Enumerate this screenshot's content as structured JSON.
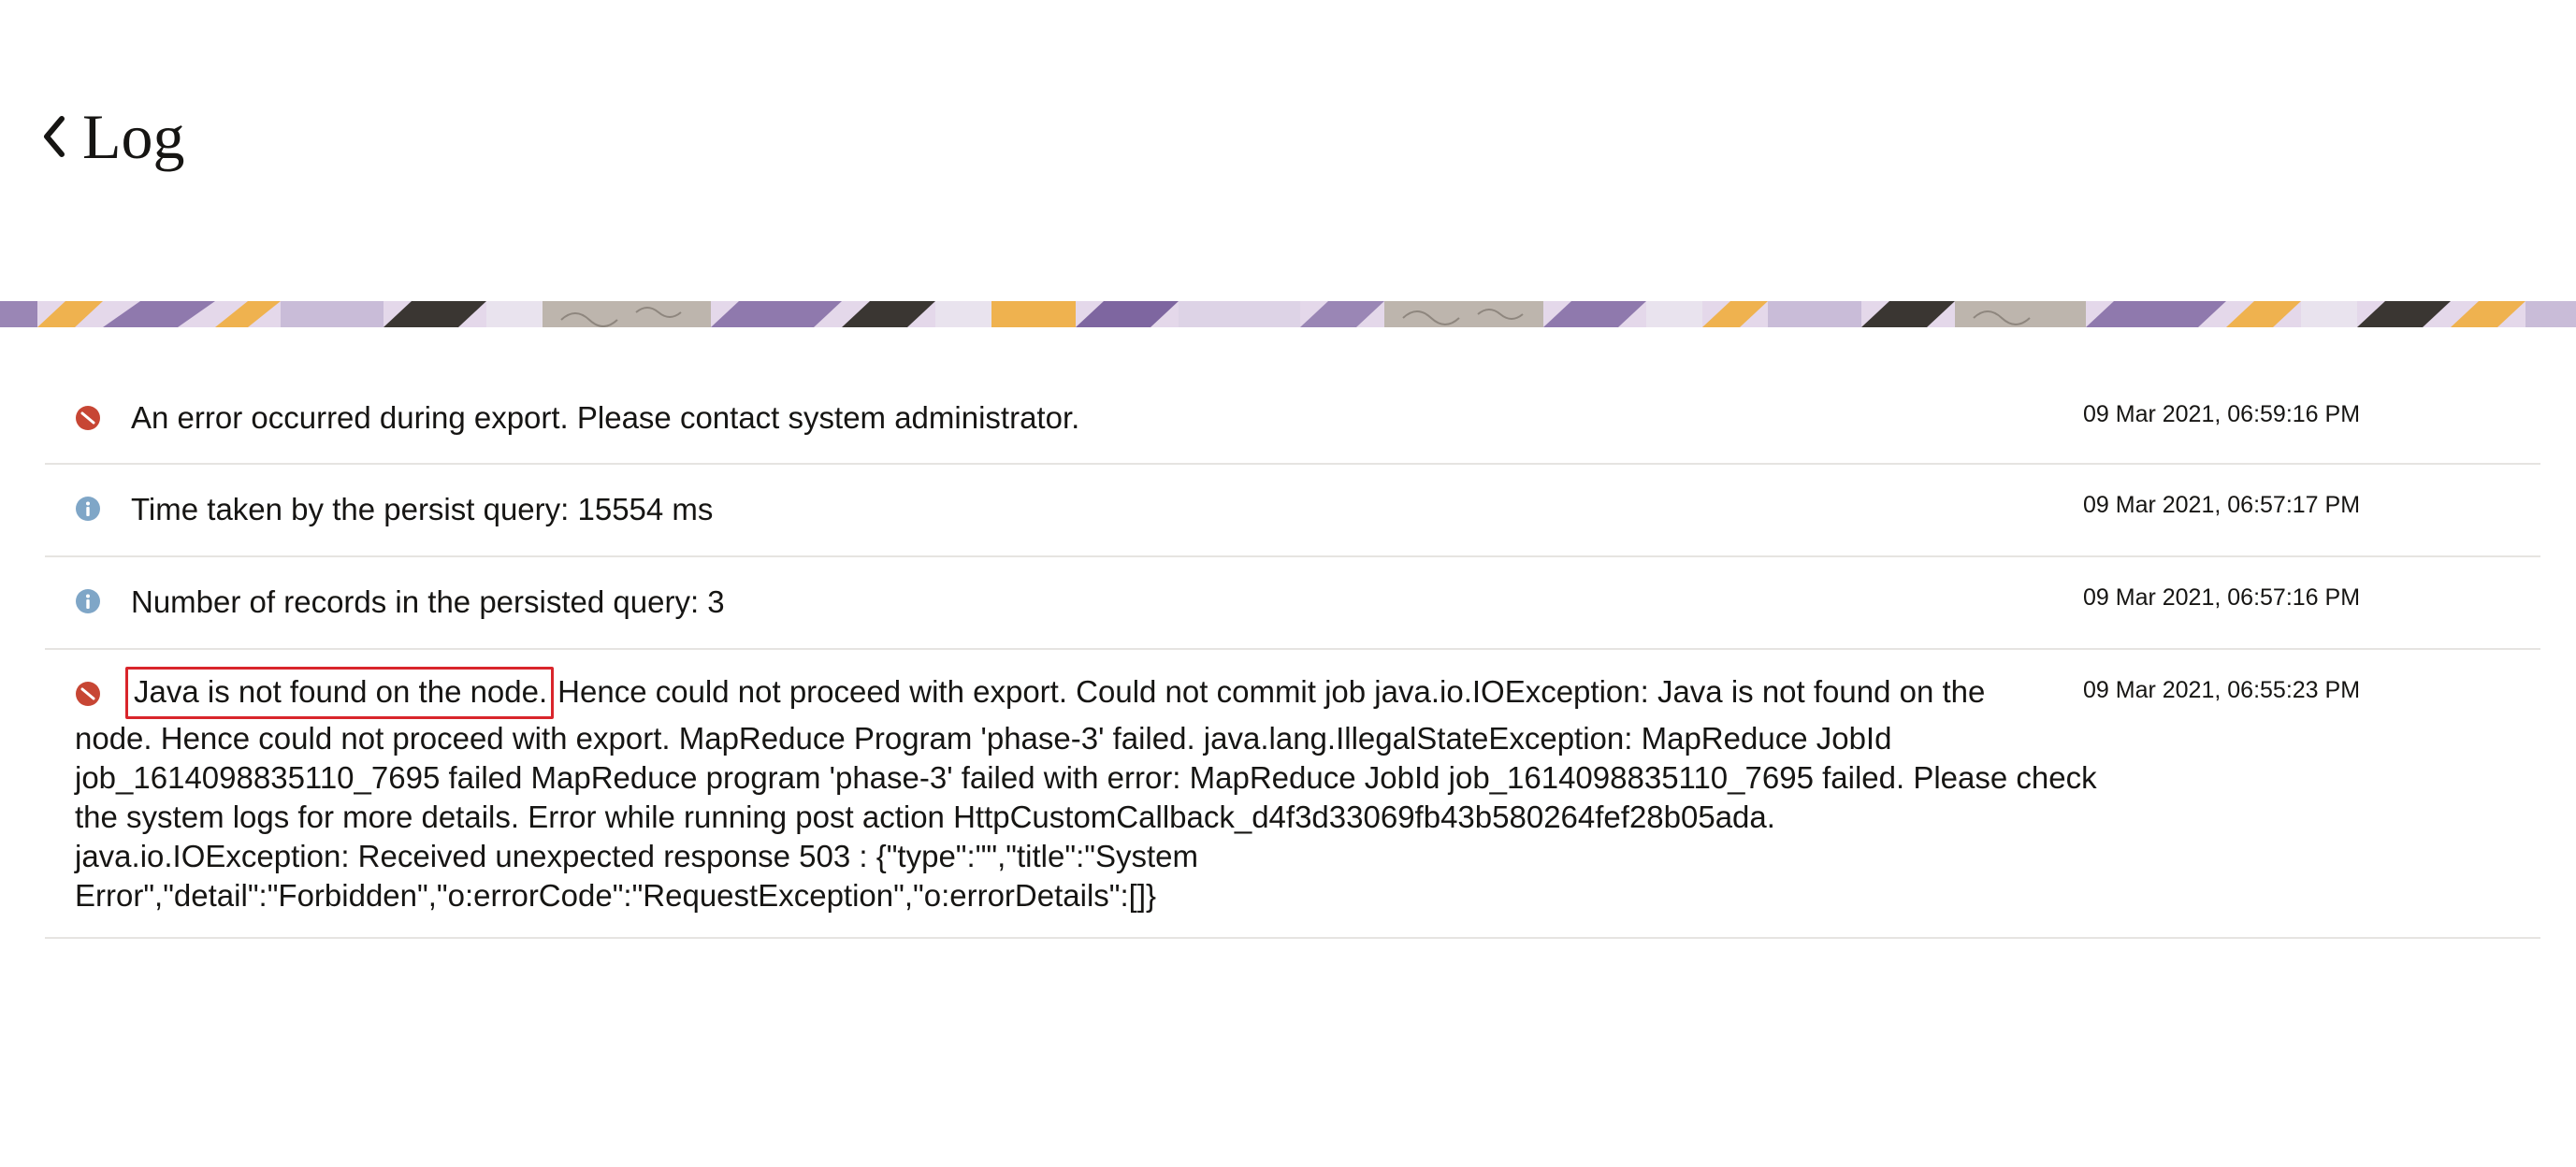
{
  "header": {
    "title": "Log",
    "back_icon": "chevron-left-icon"
  },
  "colors": {
    "error": "#c74634",
    "info": "#7fa6c7",
    "highlight_border": "#d9252b"
  },
  "logs": [
    {
      "level": "error",
      "icon": "error-icon",
      "message": "An error occurred during export. Please contact system administrator.",
      "timestamp": "09 Mar 2021, 06:59:16 PM"
    },
    {
      "level": "info",
      "icon": "info-icon",
      "message": "Time taken by the persist query: 15554 ms",
      "timestamp": "09 Mar 2021, 06:57:17 PM"
    },
    {
      "level": "info",
      "icon": "info-icon",
      "message": "Number of records in the persisted query: 3",
      "timestamp": "09 Mar 2021, 06:57:16 PM"
    },
    {
      "level": "error",
      "icon": "error-icon",
      "message_highlight": "Java is not found on the node.",
      "message_line1": "Hence could not proceed with export. Could not commit job java.io.IOException: Java is not found on the",
      "message_line2": "node. Hence could not proceed with export. MapReduce Program 'phase-3' failed. java.lang.IllegalStateException: MapReduce JobId",
      "message_line3": "job_1614098835110_7695 failed MapReduce program 'phase-3' failed with error: MapReduce JobId job_1614098835110_7695 failed. Please check",
      "message_line4": "the system logs for more details. Error while running post action HttpCustomCallback_d4f3d33069fb43b580264fef28b05ada.",
      "message_line5": "java.io.IOException: Received unexpected response 503 : {\"type\":\"\",\"title\":\"System",
      "message_line6": "Error\",\"detail\":\"Forbidden\",\"o:errorCode\":\"RequestException\",\"o:errorDetails\":[]}",
      "timestamp": "09 Mar 2021, 06:55:23 PM"
    }
  ]
}
